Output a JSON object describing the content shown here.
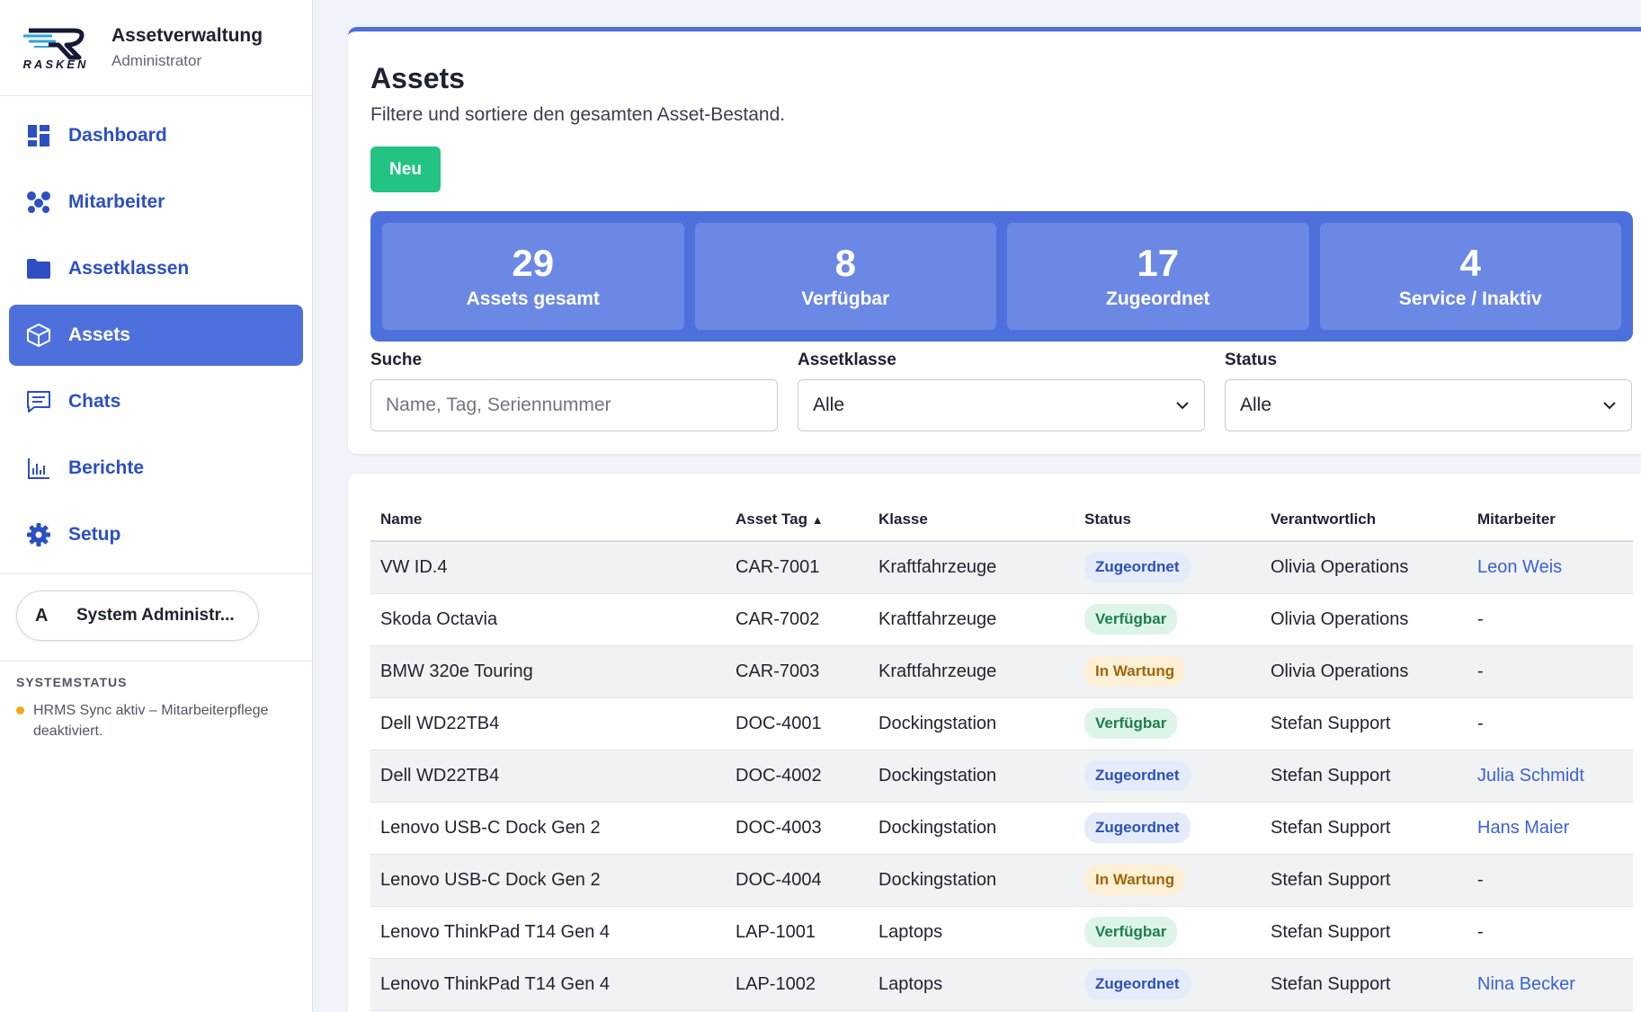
{
  "app": {
    "title": "Assetverwaltung",
    "role": "Administrator",
    "logo_word": "RASKEN"
  },
  "sidebar": {
    "items": [
      {
        "label": "Dashboard",
        "icon": "dashboard-icon",
        "active": false
      },
      {
        "label": "Mitarbeiter",
        "icon": "people-icon",
        "active": false
      },
      {
        "label": "Assetklassen",
        "icon": "folder-icon",
        "active": false
      },
      {
        "label": "Assets",
        "icon": "cube-icon",
        "active": true
      },
      {
        "label": "Chats",
        "icon": "chat-icon",
        "active": false
      },
      {
        "label": "Berichte",
        "icon": "bar-chart-icon",
        "active": false
      },
      {
        "label": "Setup",
        "icon": "gear-icon",
        "active": false
      }
    ],
    "user": {
      "initial": "A",
      "name": "System Administr..."
    },
    "system_status": {
      "title": "SYSTEMSTATUS",
      "message": "HRMS Sync aktiv – Mitarbeiterpflege deaktiviert.",
      "dot_color": "#f2a81d"
    }
  },
  "main": {
    "title": "Assets",
    "subtitle": "Filtere und sortiere den gesamten Asset-Bestand.",
    "new_button": "Neu",
    "stats": [
      {
        "value": "29",
        "label": "Assets gesamt"
      },
      {
        "value": "8",
        "label": "Verfügbar"
      },
      {
        "value": "17",
        "label": "Zugeordnet"
      },
      {
        "value": "4",
        "label": "Service / Inaktiv"
      }
    ],
    "filters": {
      "search": {
        "label": "Suche",
        "placeholder": "Name, Tag, Seriennummer"
      },
      "class": {
        "label": "Assetklasse",
        "value": "Alle"
      },
      "status": {
        "label": "Status",
        "value": "Alle"
      }
    },
    "table": {
      "columns": [
        "Name",
        "Asset Tag",
        "Klasse",
        "Status",
        "Verantwortlich",
        "Mitarbeiter"
      ],
      "sort_indicator": "▲",
      "rows": [
        {
          "name": "VW ID.4",
          "tag": "CAR-7001",
          "klasse": "Kraftfahrzeuge",
          "status": "Zugeordnet",
          "verantwortlich": "Olivia Operations",
          "mitarbeiter": "Leon Weis"
        },
        {
          "name": "Skoda Octavia",
          "tag": "CAR-7002",
          "klasse": "Kraftfahrzeuge",
          "status": "Verfügbar",
          "verantwortlich": "Olivia Operations",
          "mitarbeiter": "-"
        },
        {
          "name": "BMW 320e Touring",
          "tag": "CAR-7003",
          "klasse": "Kraftfahrzeuge",
          "status": "In Wartung",
          "verantwortlich": "Olivia Operations",
          "mitarbeiter": "-"
        },
        {
          "name": "Dell WD22TB4",
          "tag": "DOC-4001",
          "klasse": "Dockingstation",
          "status": "Verfügbar",
          "verantwortlich": "Stefan Support",
          "mitarbeiter": "-"
        },
        {
          "name": "Dell WD22TB4",
          "tag": "DOC-4002",
          "klasse": "Dockingstation",
          "status": "Zugeordnet",
          "verantwortlich": "Stefan Support",
          "mitarbeiter": "Julia Schmidt"
        },
        {
          "name": "Lenovo USB-C Dock Gen 2",
          "tag": "DOC-4003",
          "klasse": "Dockingstation",
          "status": "Zugeordnet",
          "verantwortlich": "Stefan Support",
          "mitarbeiter": "Hans Maier"
        },
        {
          "name": "Lenovo USB-C Dock Gen 2",
          "tag": "DOC-4004",
          "klasse": "Dockingstation",
          "status": "In Wartung",
          "verantwortlich": "Stefan Support",
          "mitarbeiter": "-"
        },
        {
          "name": "Lenovo ThinkPad T14 Gen 4",
          "tag": "LAP-1001",
          "klasse": "Laptops",
          "status": "Verfügbar",
          "verantwortlich": "Stefan Support",
          "mitarbeiter": "-"
        },
        {
          "name": "Lenovo ThinkPad T14 Gen 4",
          "tag": "LAP-1002",
          "klasse": "Laptops",
          "status": "Zugeordnet",
          "verantwortlich": "Stefan Support",
          "mitarbeiter": "Nina Becker"
        }
      ]
    }
  },
  "colors": {
    "accent": "#4e70dc",
    "success": "#23c483",
    "status_zugeordnet": "#2d4fb8",
    "status_verfuegbar": "#1d7f4b",
    "status_wartung": "#a0650a"
  }
}
